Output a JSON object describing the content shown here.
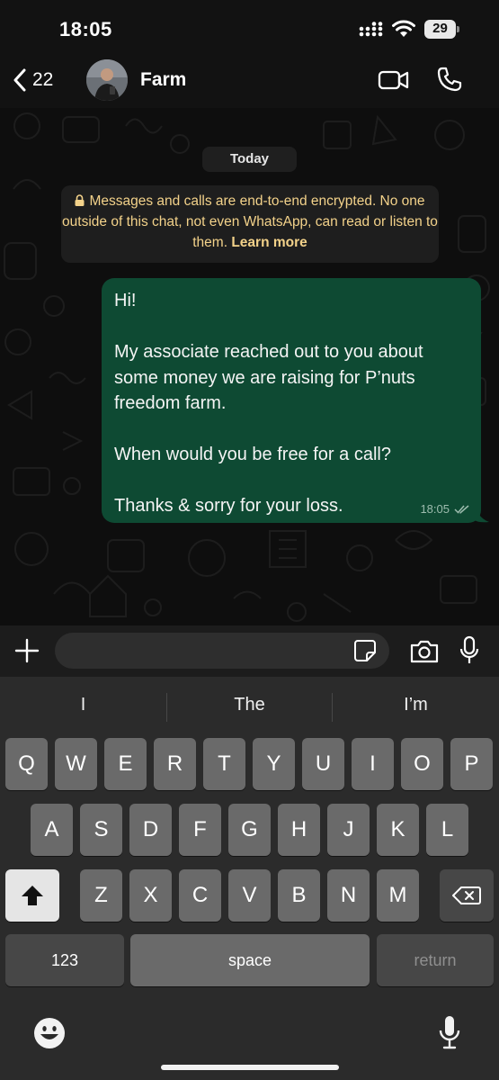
{
  "status_bar": {
    "time": "18:05",
    "battery": "29"
  },
  "header": {
    "back_count": "22",
    "contact_name": "Farm"
  },
  "chat": {
    "date_label": "Today",
    "encryption_notice": "Messages and calls are end-to-end encrypted. No one outside of this chat, not even WhatsApp, can read or listen to them.",
    "learn_more": "Learn more",
    "message": {
      "text": "Hi!\n\nMy associate reached out to you about some money we are raising for P’nuts freedom farm.\n\nWhen would you be free for a call?\n\nThanks & sorry for your loss.",
      "time": "18:05",
      "status": "read"
    }
  },
  "composer": {
    "value": "",
    "placeholder": ""
  },
  "keyboard": {
    "suggestions": [
      "I",
      "The",
      "I’m"
    ],
    "row1": [
      "Q",
      "W",
      "E",
      "R",
      "T",
      "Y",
      "U",
      "I",
      "O",
      "P"
    ],
    "row2": [
      "A",
      "S",
      "D",
      "F",
      "G",
      "H",
      "J",
      "K",
      "L"
    ],
    "row3": [
      "Z",
      "X",
      "C",
      "V",
      "B",
      "N",
      "M"
    ],
    "numbers_label": "123",
    "space_label": "space",
    "return_label": "return"
  },
  "icons": {
    "back": "chevron-left-icon",
    "video": "video-camera-icon",
    "call": "phone-icon",
    "lock": "lock-icon",
    "read": "double-check-icon",
    "plus": "plus-icon",
    "sticker": "sticker-icon",
    "camera": "camera-icon",
    "mic": "microphone-icon",
    "shift": "shift-icon",
    "delete": "backspace-icon",
    "emoji": "emoji-icon"
  },
  "colors": {
    "bubble": "#0e4a33",
    "notice_text": "#f3d28a",
    "background": "#0b0b0b",
    "keyboard": "#2b2b2b"
  }
}
